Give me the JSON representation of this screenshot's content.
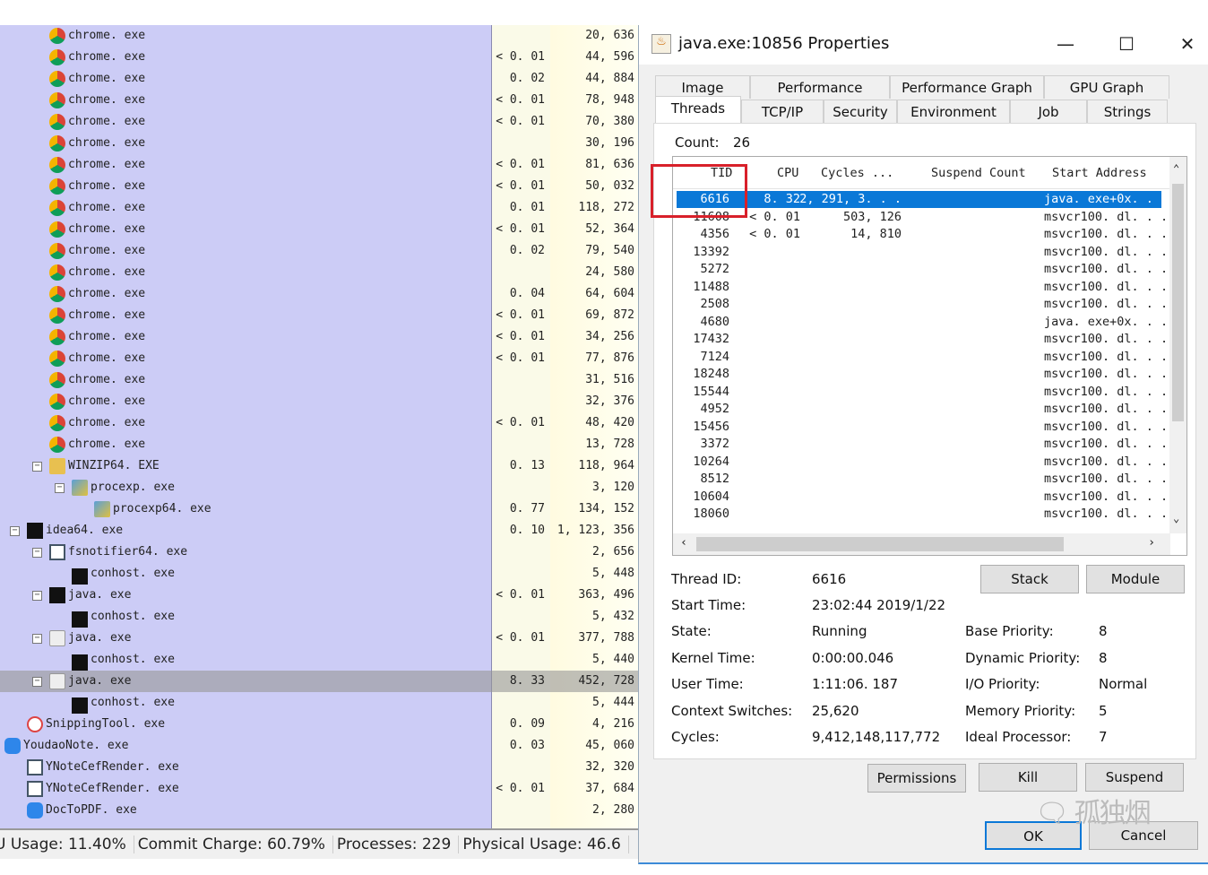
{
  "process_list": {
    "rows": [
      {
        "name": "chrome. exe",
        "cpu": "",
        "mem": "20, 636",
        "depth": 2,
        "icon": "chrome-icon"
      },
      {
        "name": "chrome. exe",
        "cpu": "< 0. 01",
        "mem": "44, 596",
        "depth": 2,
        "icon": "chrome-icon"
      },
      {
        "name": "chrome. exe",
        "cpu": "0. 02",
        "mem": "44, 884",
        "depth": 2,
        "icon": "chrome-icon"
      },
      {
        "name": "chrome. exe",
        "cpu": "< 0. 01",
        "mem": "78, 948",
        "depth": 2,
        "icon": "chrome-icon"
      },
      {
        "name": "chrome. exe",
        "cpu": "< 0. 01",
        "mem": "70, 380",
        "depth": 2,
        "icon": "chrome-icon"
      },
      {
        "name": "chrome. exe",
        "cpu": "",
        "mem": "30, 196",
        "depth": 2,
        "icon": "chrome-icon"
      },
      {
        "name": "chrome. exe",
        "cpu": "< 0. 01",
        "mem": "81, 636",
        "depth": 2,
        "icon": "chrome-icon"
      },
      {
        "name": "chrome. exe",
        "cpu": "< 0. 01",
        "mem": "50, 032",
        "depth": 2,
        "icon": "chrome-icon"
      },
      {
        "name": "chrome. exe",
        "cpu": "0. 01",
        "mem": "118, 272",
        "depth": 2,
        "icon": "chrome-icon"
      },
      {
        "name": "chrome. exe",
        "cpu": "< 0. 01",
        "mem": "52, 364",
        "depth": 2,
        "icon": "chrome-icon"
      },
      {
        "name": "chrome. exe",
        "cpu": "0. 02",
        "mem": "79, 540",
        "depth": 2,
        "icon": "chrome-icon"
      },
      {
        "name": "chrome. exe",
        "cpu": "",
        "mem": "24, 580",
        "depth": 2,
        "icon": "chrome-icon"
      },
      {
        "name": "chrome. exe",
        "cpu": "0. 04",
        "mem": "64, 604",
        "depth": 2,
        "icon": "chrome-icon"
      },
      {
        "name": "chrome. exe",
        "cpu": "< 0. 01",
        "mem": "69, 872",
        "depth": 2,
        "icon": "chrome-icon"
      },
      {
        "name": "chrome. exe",
        "cpu": "< 0. 01",
        "mem": "34, 256",
        "depth": 2,
        "icon": "chrome-icon"
      },
      {
        "name": "chrome. exe",
        "cpu": "< 0. 01",
        "mem": "77, 876",
        "depth": 2,
        "icon": "chrome-icon"
      },
      {
        "name": "chrome. exe",
        "cpu": "",
        "mem": "31, 516",
        "depth": 2,
        "icon": "chrome-icon"
      },
      {
        "name": "chrome. exe",
        "cpu": "",
        "mem": "32, 376",
        "depth": 2,
        "icon": "chrome-icon"
      },
      {
        "name": "chrome. exe",
        "cpu": "< 0. 01",
        "mem": "48, 420",
        "depth": 2,
        "icon": "chrome-icon"
      },
      {
        "name": "chrome. exe",
        "cpu": "",
        "mem": "13, 728",
        "depth": 2,
        "icon": "chrome-icon"
      },
      {
        "name": "WINZIP64. EXE",
        "cpu": "0. 13",
        "mem": "118, 964",
        "depth": 2,
        "icon": "winzip-icon",
        "expanded": true
      },
      {
        "name": "procexp. exe",
        "cpu": "",
        "mem": "3, 120",
        "depth": 3,
        "icon": "procexp-icon",
        "expanded": true
      },
      {
        "name": "procexp64. exe",
        "cpu": "0. 77",
        "mem": "134, 152",
        "depth": 4,
        "icon": "procexp-icon"
      },
      {
        "name": "idea64. exe",
        "cpu": "0. 10",
        "mem": "1, 123, 356",
        "depth": 1,
        "icon": "intellij-icon",
        "expanded": true
      },
      {
        "name": "fsnotifier64. exe",
        "cpu": "",
        "mem": "2, 656",
        "depth": 2,
        "icon": "window-icon",
        "expanded": true
      },
      {
        "name": "conhost. exe",
        "cpu": "",
        "mem": "5, 448",
        "depth": 3,
        "icon": "console-icon"
      },
      {
        "name": "java. exe",
        "cpu": "< 0. 01",
        "mem": "363, 496",
        "depth": 2,
        "icon": "jetbrains-icon",
        "expanded": true
      },
      {
        "name": "conhost. exe",
        "cpu": "",
        "mem": "5, 432",
        "depth": 3,
        "icon": "console-icon"
      },
      {
        "name": "java. exe",
        "cpu": "< 0. 01",
        "mem": "377, 788",
        "depth": 2,
        "icon": "java-icon",
        "expanded": true
      },
      {
        "name": "conhost. exe",
        "cpu": "",
        "mem": "5, 440",
        "depth": 3,
        "icon": "console-icon"
      },
      {
        "name": "java. exe",
        "cpu": "8. 33",
        "mem": "452, 728",
        "depth": 2,
        "icon": "java-icon",
        "expanded": true,
        "selected": true
      },
      {
        "name": "conhost. exe",
        "cpu": "",
        "mem": "5, 444",
        "depth": 3,
        "icon": "console-icon"
      },
      {
        "name": "SnippingTool. exe",
        "cpu": "0. 09",
        "mem": "4, 216",
        "depth": 1,
        "icon": "scissors-icon"
      },
      {
        "name": "YoudaoNote. exe",
        "cpu": "0. 03",
        "mem": "45, 060",
        "depth": 0,
        "icon": "youdao-icon"
      },
      {
        "name": "YNoteCefRender. exe",
        "cpu": "",
        "mem": "32, 320",
        "depth": 1,
        "icon": "window-icon"
      },
      {
        "name": "YNoteCefRender. exe",
        "cpu": "< 0. 01",
        "mem": "37, 684",
        "depth": 1,
        "icon": "window-icon"
      },
      {
        "name": "DocToPDF. exe",
        "cpu": "",
        "mem": "2, 280",
        "depth": 1,
        "icon": "youdao-icon"
      }
    ]
  },
  "status": {
    "cpu": "U Usage: 11.40%",
    "commit": "Commit Charge: 60.79%",
    "processes": "Processes: 229",
    "physical": "Physical Usage: 46.6"
  },
  "dialog": {
    "title": "java.exe:10856 Properties",
    "tabs_row1": [
      "Image",
      "Performance",
      "Performance Graph",
      "GPU Graph"
    ],
    "tabs_row2": [
      "Threads",
      "TCP/IP",
      "Security",
      "Environment",
      "Job",
      "Strings"
    ],
    "active_tab": "Threads",
    "count_label": "Count:",
    "count": "26",
    "columns": [
      "TID",
      "CPU",
      "Cycles ...",
      "Suspend Count",
      "Start Address"
    ],
    "threads": [
      {
        "tid": "6616",
        "cpu": "8. 32",
        "cycles": "2, 291, 3. . .",
        "start": "java. exe+0x. . .",
        "selected": true
      },
      {
        "tid": "11608",
        "cpu": "< 0. 01",
        "cycles": "503, 126",
        "start": "msvcr100. dl. . ."
      },
      {
        "tid": "4356",
        "cpu": "< 0. 01",
        "cycles": "14, 810",
        "start": "msvcr100. dl. . ."
      },
      {
        "tid": "13392",
        "cpu": "",
        "cycles": "",
        "start": "msvcr100. dl. . ."
      },
      {
        "tid": "5272",
        "cpu": "",
        "cycles": "",
        "start": "msvcr100. dl. . ."
      },
      {
        "tid": "11488",
        "cpu": "",
        "cycles": "",
        "start": "msvcr100. dl. . ."
      },
      {
        "tid": "2508",
        "cpu": "",
        "cycles": "",
        "start": "msvcr100. dl. . ."
      },
      {
        "tid": "4680",
        "cpu": "",
        "cycles": "",
        "start": "java. exe+0x. . ."
      },
      {
        "tid": "17432",
        "cpu": "",
        "cycles": "",
        "start": "msvcr100. dl. . ."
      },
      {
        "tid": "7124",
        "cpu": "",
        "cycles": "",
        "start": "msvcr100. dl. . ."
      },
      {
        "tid": "18248",
        "cpu": "",
        "cycles": "",
        "start": "msvcr100. dl. . ."
      },
      {
        "tid": "15544",
        "cpu": "",
        "cycles": "",
        "start": "msvcr100. dl. . ."
      },
      {
        "tid": "4952",
        "cpu": "",
        "cycles": "",
        "start": "msvcr100. dl. . ."
      },
      {
        "tid": "15456",
        "cpu": "",
        "cycles": "",
        "start": "msvcr100. dl. . ."
      },
      {
        "tid": "3372",
        "cpu": "",
        "cycles": "",
        "start": "msvcr100. dl. . ."
      },
      {
        "tid": "10264",
        "cpu": "",
        "cycles": "",
        "start": "msvcr100. dl. . ."
      },
      {
        "tid": "8512",
        "cpu": "",
        "cycles": "",
        "start": "msvcr100. dl. . ."
      },
      {
        "tid": "10604",
        "cpu": "",
        "cycles": "",
        "start": "msvcr100. dl. . ."
      },
      {
        "tid": "18060",
        "cpu": "",
        "cycles": "",
        "start": "msvcr100. dl. . ."
      }
    ],
    "details_left": [
      {
        "label": "Thread ID:",
        "value": "6616"
      },
      {
        "label": "Start Time:",
        "value": "23:02:44   2019/1/22"
      },
      {
        "label": "State:",
        "value": "Running"
      },
      {
        "label": "Kernel Time:",
        "value": "0:00:00.046"
      },
      {
        "label": "User Time:",
        "value": "1:11:06. 187"
      },
      {
        "label": "Context Switches:",
        "value": "25,620"
      },
      {
        "label": "Cycles:",
        "value": "9,412,148,117,772"
      }
    ],
    "details_right": [
      {
        "label": "Base Priority:",
        "value": "8"
      },
      {
        "label": "Dynamic Priority:",
        "value": "8"
      },
      {
        "label": "I/O Priority:",
        "value": "Normal"
      },
      {
        "label": "Memory Priority:",
        "value": "5"
      },
      {
        "label": "Ideal Processor:",
        "value": "7"
      }
    ],
    "buttons": {
      "stack": "Stack",
      "module": "Module",
      "permissions": "Permissions",
      "kill": "Kill",
      "suspend": "Suspend",
      "ok": "OK",
      "cancel": "Cancel"
    },
    "watermark": "孤独烟"
  },
  "colors": {
    "name_column": "#ccccf6",
    "selection": "#0a78d7",
    "highlight_box": "#d8202a"
  }
}
